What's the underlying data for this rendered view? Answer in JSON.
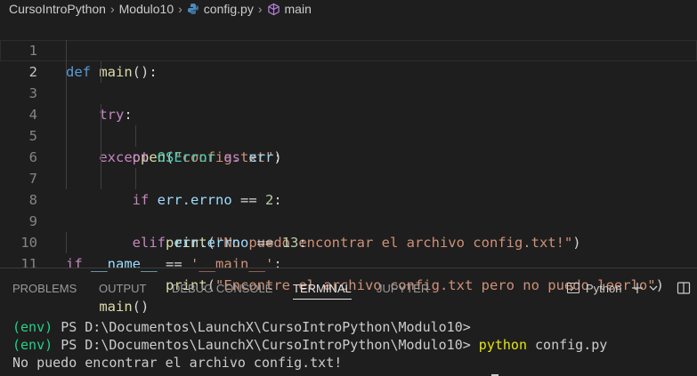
{
  "breadcrumb": {
    "items": [
      "CursoIntroPython",
      "Modulo10",
      "config.py",
      "main"
    ],
    "separator": ">"
  },
  "editor": {
    "lines": [
      {
        "num": "1"
      },
      {
        "num": "2"
      },
      {
        "num": "3"
      },
      {
        "num": "4"
      },
      {
        "num": "5"
      },
      {
        "num": "6"
      },
      {
        "num": "7"
      },
      {
        "num": "8"
      },
      {
        "num": "9"
      },
      {
        "num": "10"
      },
      {
        "num": "11"
      }
    ],
    "tokens": {
      "def": "def",
      "main_name": "main",
      "parens_colon": "():",
      "try": "try",
      "colon": ":",
      "open": "open",
      "lparen": "(",
      "rparen": ")",
      "config_str": "\"config.txt\"",
      "except": "except",
      "oserror": "OSError",
      "as": "as",
      "err": "err",
      "if": "if",
      "err_errno": "err.errno",
      "eq": "==",
      "two": "2",
      "print": "print",
      "msg1": "\"No puedo encontrar el archivo config.txt!\"",
      "elif": "elif",
      "thirteen": "13",
      "msg2": "\"Encontre el archivo config.txt pero no puedo leerlo\"",
      "dunder_name": "__name__",
      "main_str": "'__main__'",
      "main_call": "main",
      "call_parens": "()"
    }
  },
  "panel": {
    "tabs": [
      "PROBLEMS",
      "OUTPUT",
      "DEBUG CONSOLE",
      "TERMINAL",
      "JUPYTER"
    ],
    "active_tab": "TERMINAL",
    "terminal_profile": "Python"
  },
  "terminal": {
    "env": "(env)",
    "prompt": "PS D:\\Documentos\\LaunchX\\CursoIntroPython\\Modulo10>",
    "command": "python",
    "command_arg": "config.py",
    "output": "No puedo encontrar el archivo config.txt!"
  },
  "colors": {
    "background": "#1e1e1e",
    "keyword": "#569cd6",
    "control": "#c586c0",
    "function": "#dcdcaa",
    "string": "#ce9178",
    "number": "#b5cea8",
    "variable": "#9cdcfe",
    "class": "#4ec9b0",
    "env_green": "#23d18b",
    "command_yellow": "#e5e510"
  }
}
